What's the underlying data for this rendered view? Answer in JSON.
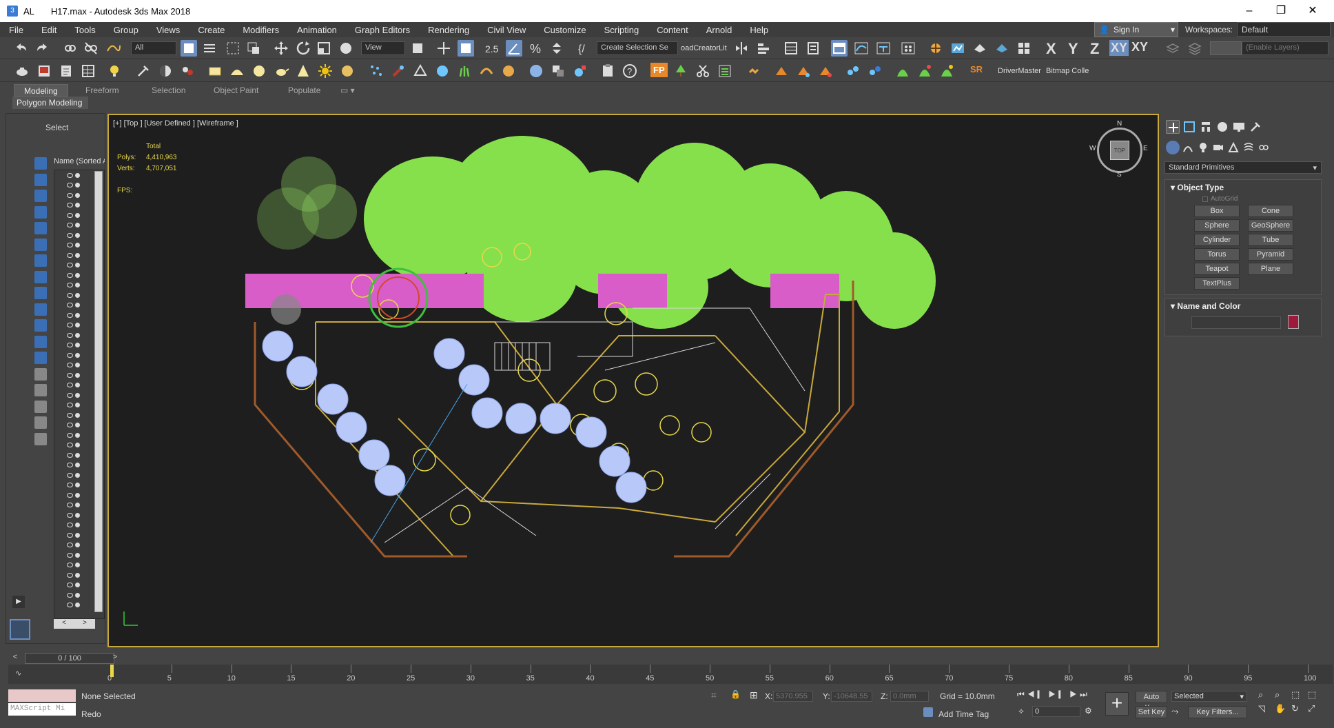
{
  "window": {
    "app_short": "AL",
    "title": "H17.max - Autodesk 3ds Max 2018",
    "minimize": "–",
    "maximize": "❐",
    "close": "✕"
  },
  "menu": [
    "File",
    "Edit",
    "Tools",
    "Group",
    "Views",
    "Create",
    "Modifiers",
    "Animation",
    "Graph Editors",
    "Rendering",
    "Civil View",
    "Customize",
    "Scripting",
    "Content",
    "Arnold",
    "Help"
  ],
  "account": {
    "sign_in": "Sign In",
    "workspaces_label": "Workspaces:",
    "workspace": "Default"
  },
  "toolbar": {
    "filter": "All",
    "ref_coord": "View",
    "named_selection": "Create Selection Se",
    "plugin_text": "oadCreatorLit",
    "axes": [
      "X",
      "Y",
      "Z",
      "XY",
      "XY"
    ],
    "enable_layers": "(Enable Layers)",
    "sr_label": "SR",
    "driver_master": "DriverMaster",
    "bitmap": "Bitmap Colle",
    "fp": "FP"
  },
  "ribbon": {
    "tabs": [
      "Modeling",
      "Freeform",
      "Selection",
      "Object Paint",
      "Populate"
    ],
    "active_tab": "Modeling",
    "panel": "Polygon Modeling"
  },
  "scene_explorer": {
    "select_label": "Select",
    "column_header": "Name (Sorted A"
  },
  "viewport": {
    "label": "[+] [Top ] [User Defined ] [Wireframe ]",
    "stats_total": "Total",
    "polys_label": "Polys:",
    "polys_value": "4,410,963",
    "verts_label": "Verts:",
    "verts_value": "4,707,051",
    "fps_label": "FPS:",
    "viewcube": {
      "n": "N",
      "s": "S",
      "e": "E",
      "w": "W",
      "face": "TOP"
    }
  },
  "command_panel": {
    "category": "Standard Primitives",
    "object_type_title": "Object Type",
    "autogrid": "AutoGrid",
    "buttons": [
      "Box",
      "Cone",
      "Sphere",
      "GeoSphere",
      "Cylinder",
      "Tube",
      "Torus",
      "Pyramid",
      "Teapot",
      "Plane",
      "TextPlus"
    ],
    "name_color_title": "Name and Color",
    "object_color": "#9e1a3c"
  },
  "timeline": {
    "frame_display": "0 / 100",
    "ticks": [
      "0",
      "5",
      "10",
      "15",
      "20",
      "25",
      "30",
      "35",
      "40",
      "45",
      "50",
      "55",
      "60",
      "65",
      "70",
      "75",
      "80",
      "85",
      "90",
      "95",
      "100"
    ]
  },
  "status": {
    "maxscript": "MAXScript Mi",
    "selection": "None Selected",
    "prompt": "Redo",
    "x_label": "X:",
    "x_value": "5370.955",
    "y_label": "Y:",
    "y_value": "-10648.55",
    "z_label": "Z:",
    "z_value": "0.0mm",
    "grid": "Grid = 10.0mm",
    "add_time_tag": "Add Time Tag",
    "auto_key": "Auto Key",
    "set_key": "Set Key",
    "key_mode": "Selected",
    "key_filters": "Key Filters...",
    "current_frame": "0"
  }
}
